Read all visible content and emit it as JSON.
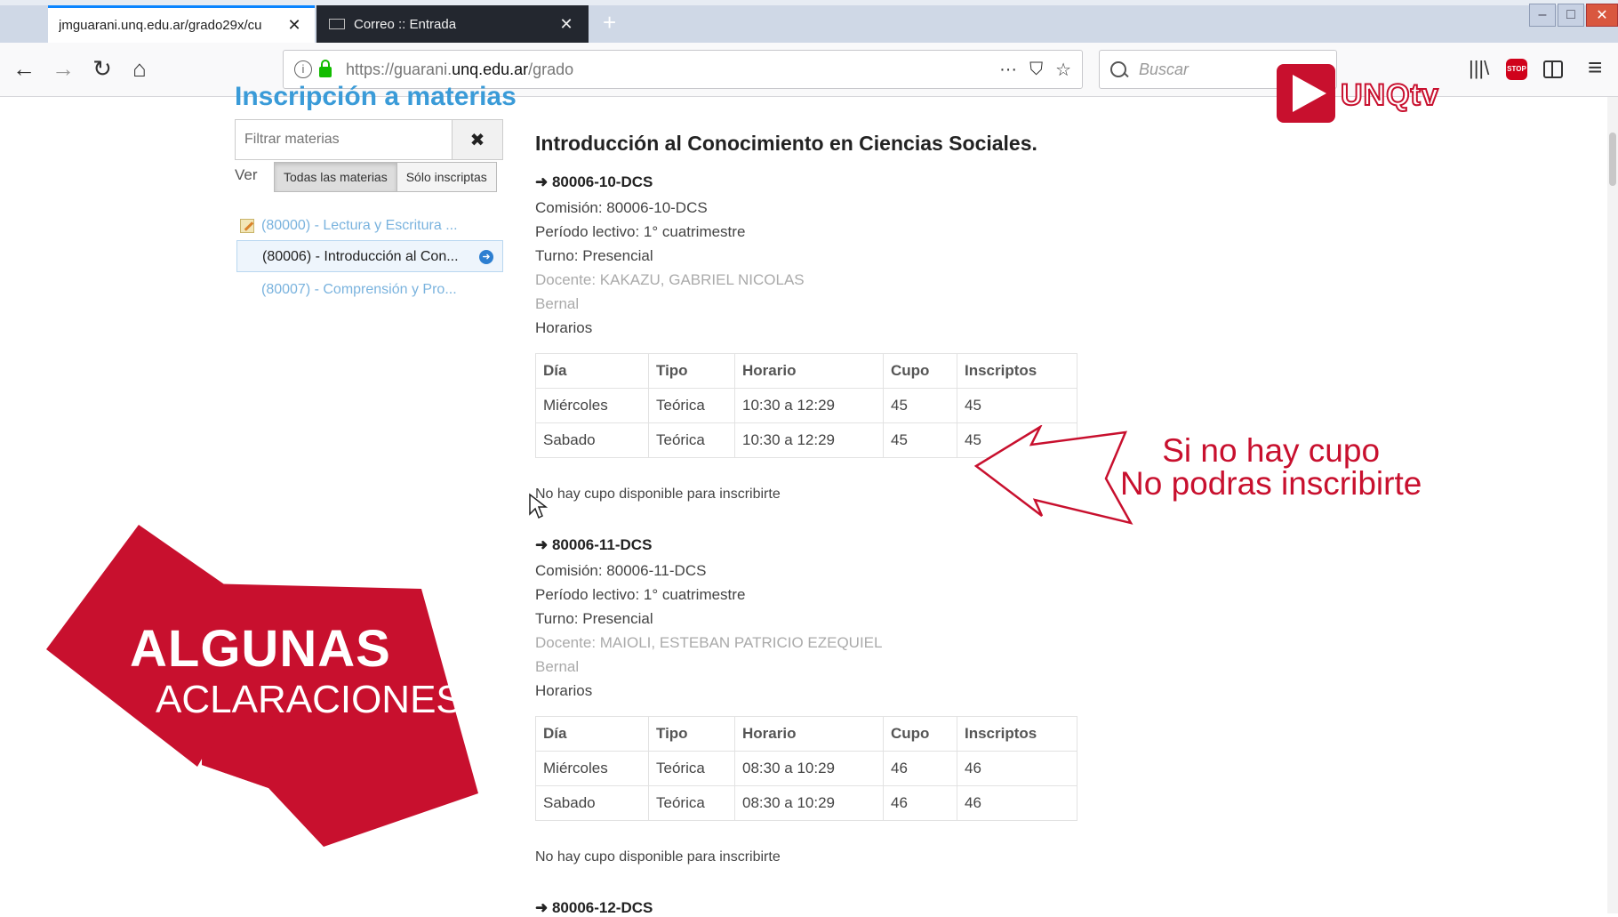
{
  "browser": {
    "tabs": [
      {
        "label": "jmguarani.unq.edu.ar/grado29x/cu",
        "active": true
      },
      {
        "label": "Correo :: Entrada",
        "active": false
      }
    ],
    "url": {
      "prefix": "https://guarani.",
      "domain": "unq.edu.ar",
      "path": "/grado"
    },
    "search_placeholder": "Buscar",
    "page_actions": "···"
  },
  "page": {
    "heading": "Inscripción a materias",
    "filter_placeholder": "Filtrar materias",
    "ver_label": "Ver",
    "view_toggle": {
      "all": "Todas las materias",
      "only": "Sólo inscriptas",
      "selected": "all"
    },
    "materias": [
      {
        "label": "(80000) - Lectura y Escritura ...",
        "selected": false,
        "icon": "pencil-icon"
      },
      {
        "label": "(80006) - Introducción al Con...",
        "selected": true
      },
      {
        "label": "(80007) - Comprensión y Pro...",
        "selected": false
      }
    ],
    "course_title": "Introducción al Conocimiento en Ciencias Sociales.",
    "comisiones": [
      {
        "code": "➜ 80006-10-DCS",
        "comision": "Comisión: 80006-10-DCS",
        "periodo": "Período lectivo: 1° cuatrimestre",
        "turno": "Turno: Presencial",
        "docente": "Docente: KAKAZU, GABRIEL NICOLAS",
        "sede": "Bernal",
        "horarios_label": "Horarios",
        "headers": [
          "Día",
          "Tipo",
          "Horario",
          "Cupo",
          "Inscriptos"
        ],
        "rows": [
          [
            "Miércoles",
            "Teórica",
            "10:30 a 12:29",
            "45",
            "45"
          ],
          [
            "Sabado",
            "Teórica",
            "10:30 a 12:29",
            "45",
            "45"
          ]
        ],
        "status": "No hay cupo disponible para inscribirte"
      },
      {
        "code": "➜ 80006-11-DCS",
        "comision": "Comisión: 80006-11-DCS",
        "periodo": "Período lectivo: 1° cuatrimestre",
        "turno": "Turno: Presencial",
        "docente": "Docente: MAIOLI, ESTEBAN PATRICIO EZEQUIEL",
        "sede": "Bernal",
        "horarios_label": "Horarios",
        "headers": [
          "Día",
          "Tipo",
          "Horario",
          "Cupo",
          "Inscriptos"
        ],
        "rows": [
          [
            "Miércoles",
            "Teórica",
            "08:30 a 10:29",
            "46",
            "46"
          ],
          [
            "Sabado",
            "Teórica",
            "08:30 a 10:29",
            "46",
            "46"
          ]
        ],
        "status": "No hay cupo disponible para inscribirte"
      }
    ],
    "next_code": "➜ 80006-12-DCS"
  },
  "overlay": {
    "logo_text": "UNQtv",
    "callout_line1": "Si no hay cupo",
    "callout_line2": "No podras inscribirte",
    "banner_line1": "ALGUNAS",
    "banner_line2": "ACLARACIONES",
    "accent_color": "#c8102e"
  }
}
